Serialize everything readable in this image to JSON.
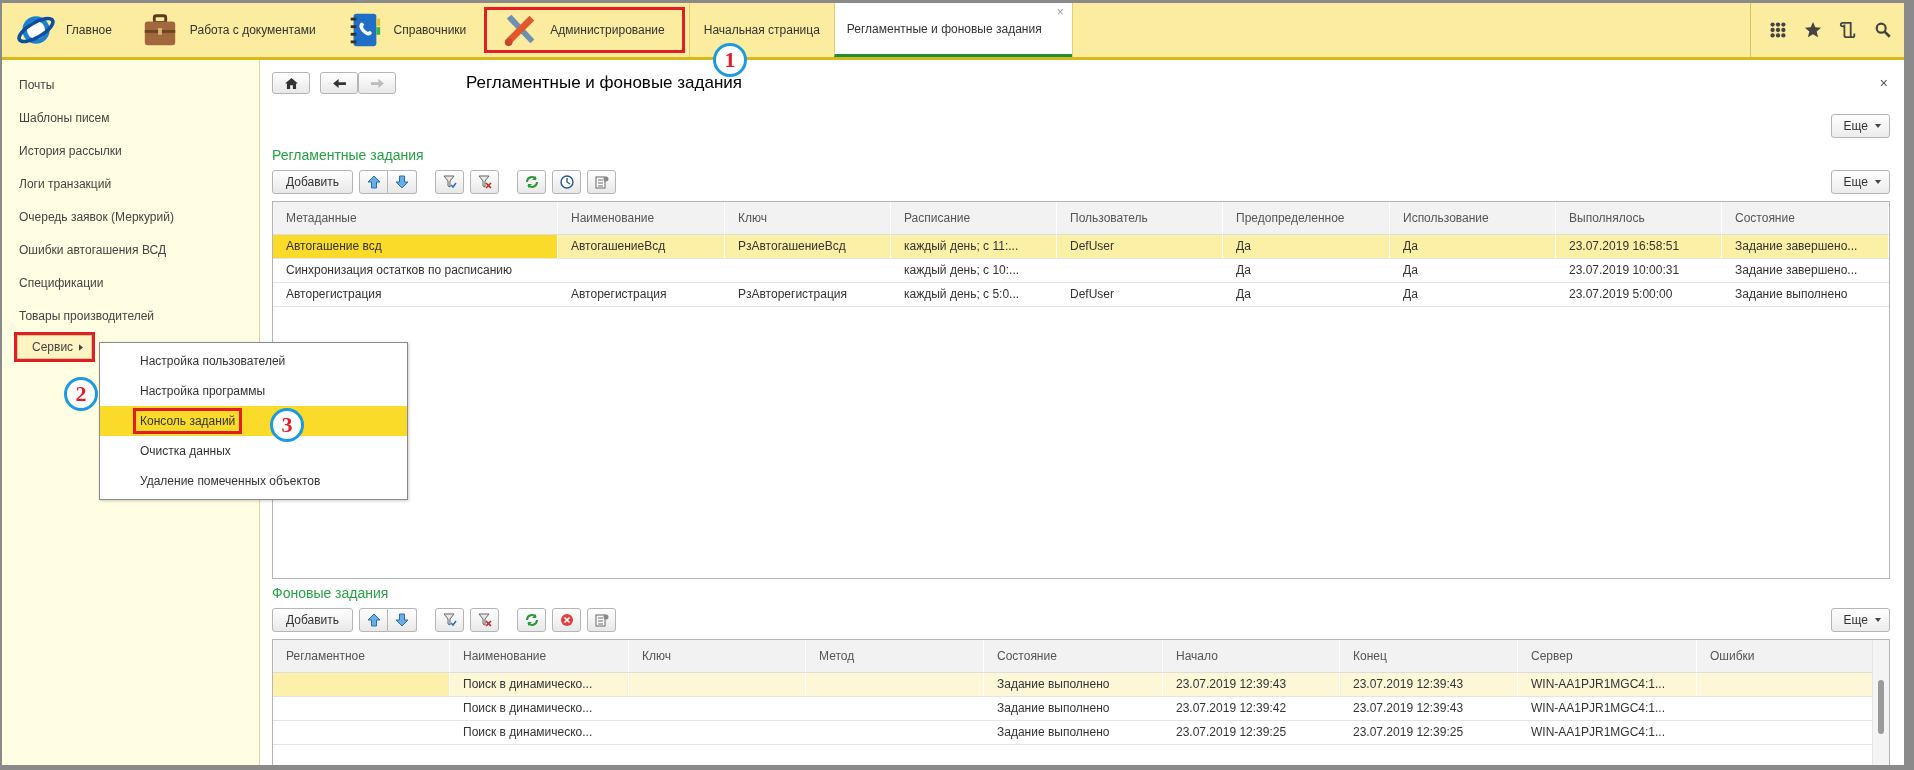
{
  "sections": [
    {
      "label": "Главное",
      "outlined": false
    },
    {
      "label": "Работа с документами",
      "outlined": false
    },
    {
      "label": "Справочники",
      "outlined": false
    },
    {
      "label": "Администрирование",
      "outlined": true
    }
  ],
  "open_tabs": [
    {
      "label": "Начальная страница",
      "selected": false
    },
    {
      "label": "Регламентные и фоновые задания",
      "selected": true,
      "close": "×"
    }
  ],
  "sidebar": {
    "items": [
      "Почты",
      "Шаблоны писем",
      "История рассылки",
      "Логи транзакций",
      "Очередь заявок (Меркурий)",
      "Ошибки автогашения ВСД",
      "Спецификации",
      "Товары производителей"
    ],
    "service": {
      "label": "Сервис",
      "outlined": true
    }
  },
  "menu": {
    "items": [
      {
        "label": "Настройка пользователей",
        "selected": false,
        "outlined": false
      },
      {
        "label": "Настройка программы",
        "selected": false,
        "outlined": false
      },
      {
        "label": "Консоль заданий",
        "selected": true,
        "outlined": true
      },
      {
        "label": "Очистка данных",
        "selected": false,
        "outlined": false
      },
      {
        "label": "Удаление помеченных объектов",
        "selected": false,
        "outlined": false
      }
    ]
  },
  "form": {
    "title": "Регламентные и фоновые задания",
    "close": "×",
    "more": "Еще",
    "sections": [
      {
        "title": "Регламентные задания",
        "add": "Добавить",
        "more": "Еще",
        "columns": [
          "Метаданные",
          "Наименование",
          "Ключ",
          "Расписание",
          "Пользователь",
          "Предопределенное",
          "Использование",
          "Выполнялось",
          "Состояние"
        ],
        "rows": [
          {
            "selected": true,
            "cells": [
              "Автогашение всд",
              "АвтогашениеВсд",
              "РзАвтогашениеВсд",
              "каждый  день; с 11:...",
              "DefUser",
              "Да",
              "Да",
              "23.07.2019 16:58:51",
              "Задание завершено..."
            ]
          },
          {
            "selected": false,
            "cells": [
              "Синхронизация остатков по расписанию",
              "",
              "",
              "каждый  день; с 10:...",
              "",
              "Да",
              "Да",
              "23.07.2019 10:00:31",
              "Задание завершено..."
            ]
          },
          {
            "selected": false,
            "cells": [
              "Авторегистрация",
              "Авторегистрация",
              "РзАвторегистрация",
              "каждый  день; с 5:0...",
              "DefUser",
              "Да",
              "Да",
              "23.07.2019 5:00:00",
              "Задание выполнено"
            ]
          }
        ]
      },
      {
        "title": "Фоновые задания",
        "add": "Добавить",
        "more": "Еще",
        "columns": [
          "Регламентное",
          "Наименование",
          "Ключ",
          "Метод",
          "Состояние",
          "Начало",
          "Конец",
          "Сервер",
          "Ошибки"
        ],
        "rows": [
          {
            "selected": true,
            "cells": [
              "",
              "Поиск в динамическо...",
              "",
              "",
              "Задание выполнено",
              "23.07.2019 12:39:43",
              "23.07.2019 12:39:43",
              "WIN-AA1PJR1MGC4:1...",
              ""
            ]
          },
          {
            "selected": false,
            "cells": [
              "",
              "Поиск в динамическо...",
              "",
              "",
              "Задание выполнено",
              "23.07.2019 12:39:42",
              "23.07.2019 12:39:43",
              "WIN-AA1PJR1MGC4:1...",
              ""
            ]
          },
          {
            "selected": false,
            "cells": [
              "",
              "Поиск в динамическо...",
              "",
              "",
              "Задание выполнено",
              "23.07.2019 12:39:25",
              "23.07.2019 12:39:25",
              "WIN-AA1PJR1MGC4:1...",
              ""
            ]
          }
        ]
      }
    ]
  },
  "callouts": [
    {
      "number": "1"
    },
    {
      "number": "2"
    },
    {
      "number": "3"
    }
  ]
}
